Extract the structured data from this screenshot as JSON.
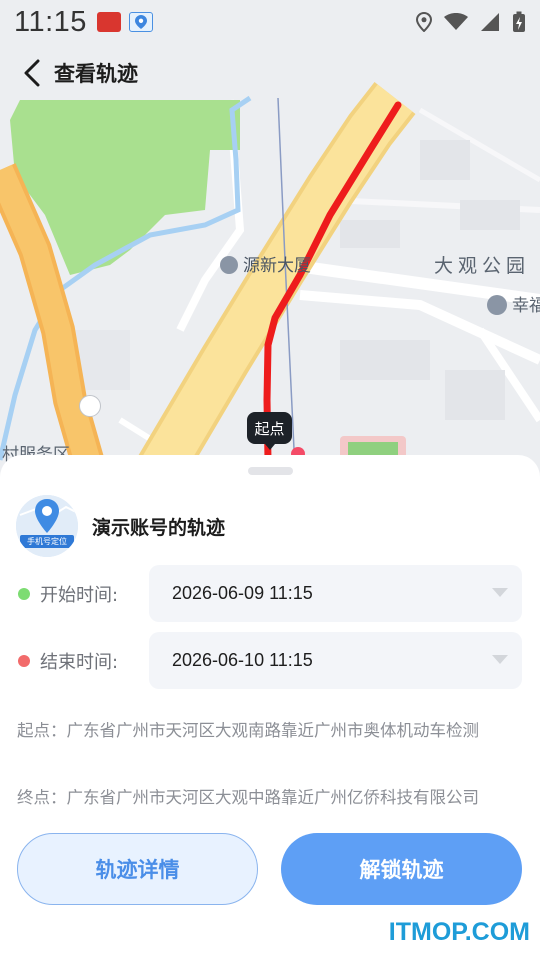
{
  "status_bar": {
    "time": "11:15",
    "notification_icons": [
      "news-app-icon",
      "map-app-icon"
    ],
    "right_icons": [
      "location-icon",
      "wifi-icon",
      "signal-icon",
      "battery-charging-icon"
    ]
  },
  "header": {
    "title": "查看轨迹",
    "back_icon": "chevron-left-icon"
  },
  "map": {
    "labels": {
      "poi_1": "源新大厦",
      "poi_2": "大观公园",
      "poi_3": "幸福",
      "poi_4": "村服务区"
    },
    "start_marker": "起点",
    "route_color": "#ff1a1a"
  },
  "sheet": {
    "track_name": "演示账号的轨迹",
    "avatar_caption": "手机号定位",
    "start_time": {
      "label": "开始时间:",
      "value": "2026-06-09 11:15",
      "dot_color": "#7ddc72"
    },
    "end_time": {
      "label": "结束时间:",
      "value": "2026-06-10 11:15",
      "dot_color": "#f26b6b"
    },
    "start_address": "起点：广东省广州市天河区大观南路靠近广州市奥体机动车检测",
    "end_address": "终点：广东省广州市天河区大观中路靠近广州亿侨科技有限公司",
    "detail_button": "轨迹详情",
    "unlock_button": "解锁轨迹"
  },
  "watermark": "ITMOP.COM"
}
